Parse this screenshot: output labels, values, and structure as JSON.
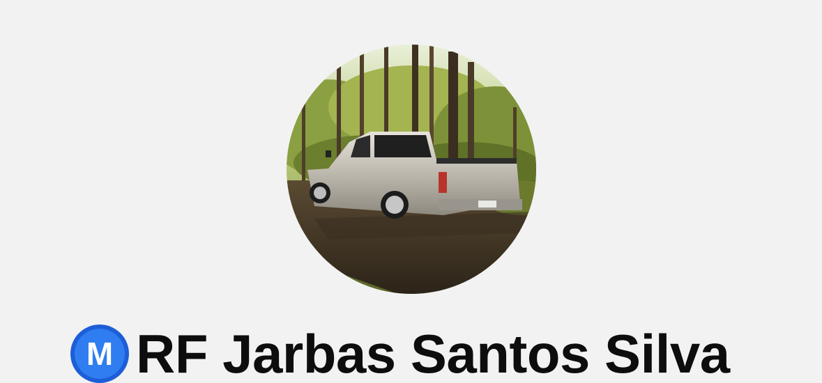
{
  "profile": {
    "display_name": "RF Jarbas Santos Silva",
    "badge_letter": "M",
    "badge_color": "#2f7df0",
    "avatar_subject": "silver pickup truck in forest"
  },
  "colors": {
    "background": "#f2f2f2",
    "name_text": "#0d0d0d"
  }
}
